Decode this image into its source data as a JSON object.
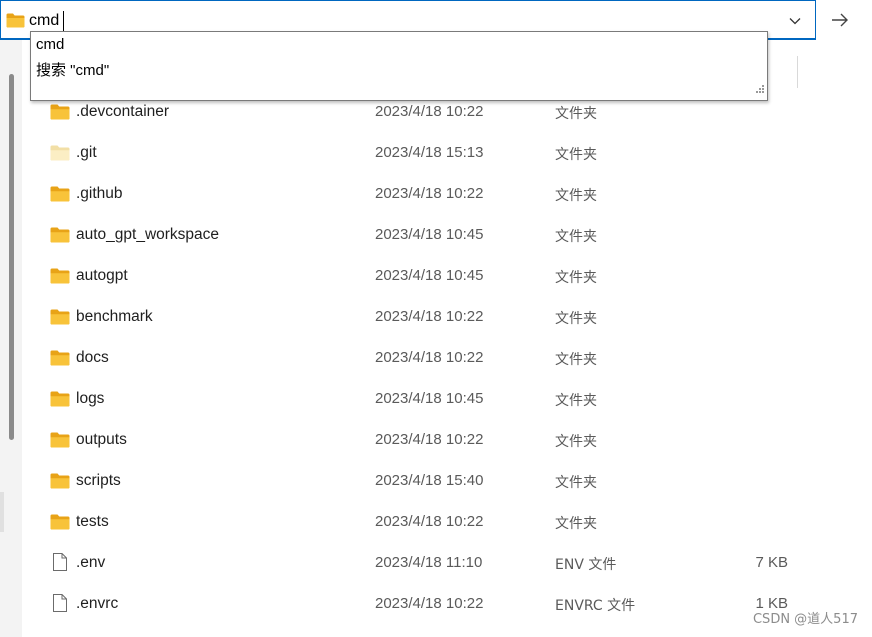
{
  "address_bar": {
    "value": "cmd"
  },
  "autocomplete": {
    "items": [
      {
        "label": "cmd"
      },
      {
        "label": "搜索 \"cmd\""
      }
    ]
  },
  "files": [
    {
      "name": ".devcontainer",
      "date": "2023/4/18 10:22",
      "type": "文件夹",
      "size": "",
      "kind": "folder"
    },
    {
      "name": ".git",
      "date": "2023/4/18 15:13",
      "type": "文件夹",
      "size": "",
      "kind": "folder-hidden"
    },
    {
      "name": ".github",
      "date": "2023/4/18 10:22",
      "type": "文件夹",
      "size": "",
      "kind": "folder"
    },
    {
      "name": "auto_gpt_workspace",
      "date": "2023/4/18 10:45",
      "type": "文件夹",
      "size": "",
      "kind": "folder"
    },
    {
      "name": "autogpt",
      "date": "2023/4/18 10:45",
      "type": "文件夹",
      "size": "",
      "kind": "folder"
    },
    {
      "name": "benchmark",
      "date": "2023/4/18 10:22",
      "type": "文件夹",
      "size": "",
      "kind": "folder"
    },
    {
      "name": "docs",
      "date": "2023/4/18 10:22",
      "type": "文件夹",
      "size": "",
      "kind": "folder"
    },
    {
      "name": "logs",
      "date": "2023/4/18 10:45",
      "type": "文件夹",
      "size": "",
      "kind": "folder"
    },
    {
      "name": "outputs",
      "date": "2023/4/18 10:22",
      "type": "文件夹",
      "size": "",
      "kind": "folder"
    },
    {
      "name": "scripts",
      "date": "2023/4/18 15:40",
      "type": "文件夹",
      "size": "",
      "kind": "folder"
    },
    {
      "name": "tests",
      "date": "2023/4/18 10:22",
      "type": "文件夹",
      "size": "",
      "kind": "folder"
    },
    {
      "name": ".env",
      "date": "2023/4/18 11:10",
      "type": "ENV 文件",
      "size": "7 KB",
      "kind": "file"
    },
    {
      "name": ".envrc",
      "date": "2023/4/18 10:22",
      "type": "ENVRC 文件",
      "size": "1 KB",
      "kind": "file"
    }
  ],
  "watermark": "CSDN @道人517",
  "colors": {
    "accent": "#0067c0",
    "folder": "#f8c33a",
    "folder_dark": "#e8a317"
  }
}
